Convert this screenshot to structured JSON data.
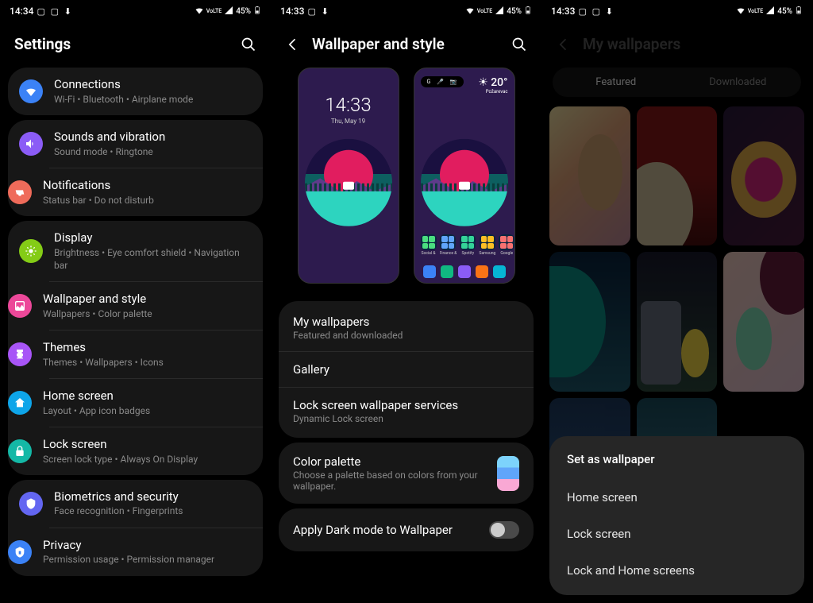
{
  "status": {
    "time_a": "14:34",
    "time_b": "14:33",
    "time_c": "14:33",
    "battery": "45%",
    "net_label": "VoLTE"
  },
  "screen1": {
    "title": "Settings",
    "groups": [
      [
        {
          "key": "connections",
          "title": "Connections",
          "sub": "Wi-Fi  •  Bluetooth  •  Airplane mode",
          "iconClass": "ic-wifi"
        }
      ],
      [
        {
          "key": "sounds",
          "title": "Sounds and vibration",
          "sub": "Sound mode  •  Ringtone",
          "iconClass": "ic-sound"
        },
        {
          "key": "notifications",
          "title": "Notifications",
          "sub": "Status bar  •  Do not disturb",
          "iconClass": "ic-notif"
        }
      ],
      [
        {
          "key": "display",
          "title": "Display",
          "sub": "Brightness  •  Eye comfort shield  •  Navigation bar",
          "iconClass": "ic-display"
        },
        {
          "key": "wallpaper",
          "title": "Wallpaper and style",
          "sub": "Wallpapers  •  Color palette",
          "iconClass": "ic-wall"
        },
        {
          "key": "themes",
          "title": "Themes",
          "sub": "Themes  •  Wallpapers  •  Icons",
          "iconClass": "ic-themes"
        },
        {
          "key": "home",
          "title": "Home screen",
          "sub": "Layout  •  App icon badges",
          "iconClass": "ic-home"
        },
        {
          "key": "lock",
          "title": "Lock screen",
          "sub": "Screen lock type  •  Always On Display",
          "iconClass": "ic-lock"
        }
      ],
      [
        {
          "key": "biometrics",
          "title": "Biometrics and security",
          "sub": "Face recognition  •  Fingerprints",
          "iconClass": "ic-bio"
        },
        {
          "key": "privacy",
          "title": "Privacy",
          "sub": "Permission usage  •  Permission manager",
          "iconClass": "ic-priv"
        }
      ]
    ]
  },
  "screen2": {
    "title": "Wallpaper and style",
    "lock_preview": {
      "time": "14:33",
      "date": "Thu, May 19"
    },
    "home_preview": {
      "temp": "20°",
      "city": "Požarevac",
      "search_glyph": "G"
    },
    "list": [
      {
        "title": "My wallpapers",
        "sub": "Featured and downloaded"
      },
      {
        "title": "Gallery",
        "sub": ""
      },
      {
        "title": "Lock screen wallpaper services",
        "sub": "Dynamic Lock screen"
      }
    ],
    "palette": {
      "title": "Color palette",
      "sub": "Choose a palette based on colors from your wallpaper."
    },
    "dark_mode_label": "Apply Dark mode to Wallpaper"
  },
  "screen3": {
    "title": "My wallpapers",
    "tabs": [
      "Featured",
      "Downloaded"
    ],
    "active_tab": 0,
    "sheet": {
      "title": "Set as wallpaper",
      "options": [
        "Home screen",
        "Lock screen",
        "Lock and Home screens"
      ]
    }
  }
}
